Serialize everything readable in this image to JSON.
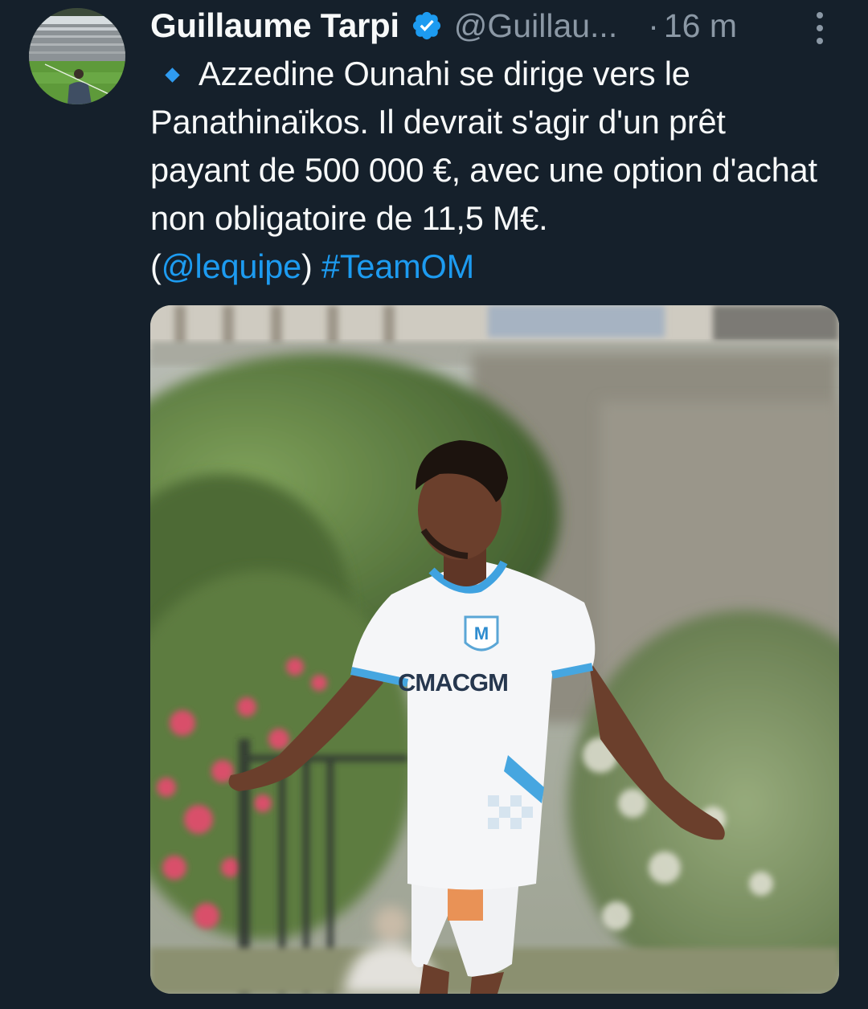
{
  "tweet": {
    "author": {
      "display_name": "Guillaume Tarpi",
      "handle": "@Guillau...",
      "verified": true,
      "avatar_icon": "stadium-photo-avatar"
    },
    "time_separator": "·",
    "timestamp": "16 m",
    "more_icon": "more-vertical-icon",
    "body": {
      "bullet_icon": "small-blue-diamond-emoji",
      "text_before": "Azzedine Ounahi se dirige vers le Panathinaïkos. Il devrait s'agir d'un prêt payant de 500 000 €, avec une option d'achat non obligatoire de 11,5 M€.",
      "paren_open": "(",
      "mention": "@lequipe",
      "paren_close": ")",
      "hashtag": "#TeamOM"
    },
    "media": {
      "type": "photo",
      "jersey_text": "CMACGM"
    }
  },
  "colors": {
    "background": "#15202b",
    "text_primary": "#f7f9f9",
    "text_secondary": "#8b98a5",
    "link": "#1d9bf0",
    "verified_badge": "#1d9bf0"
  }
}
